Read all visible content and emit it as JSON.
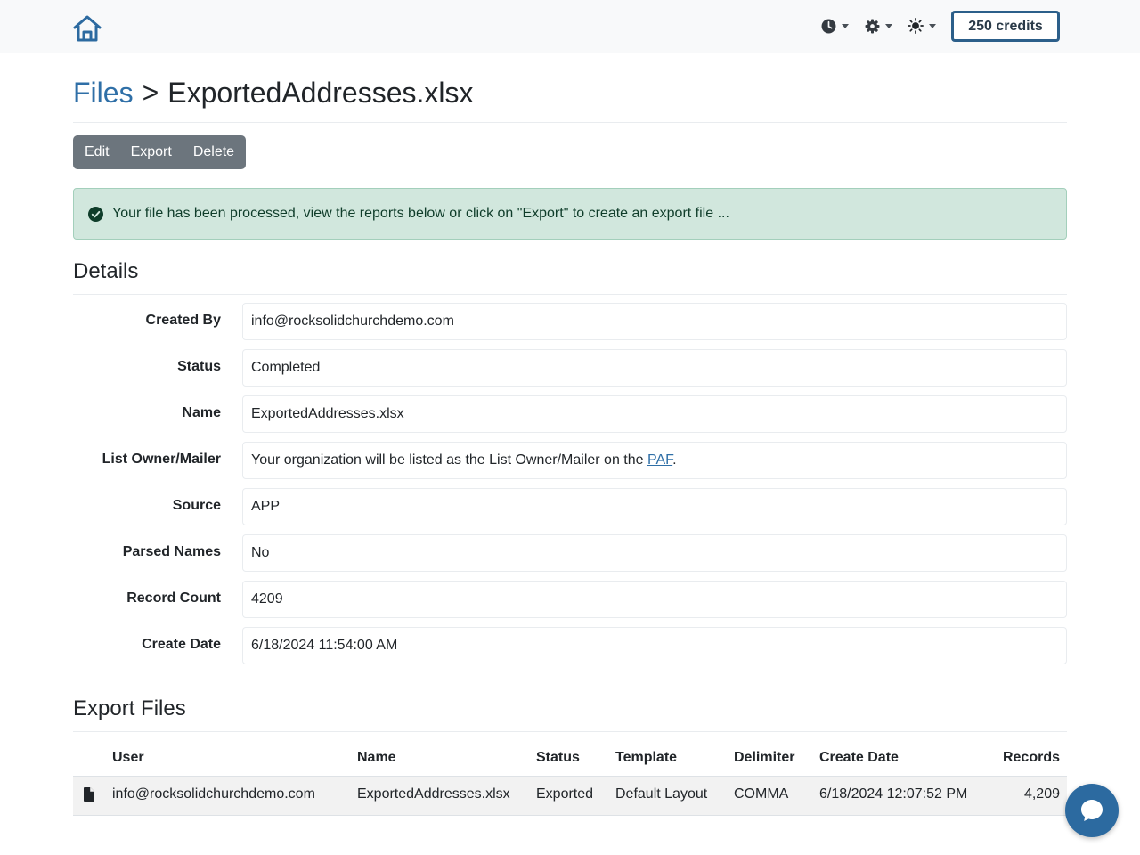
{
  "header": {
    "credits_label": "250 credits",
    "tools": [
      "clock-icon",
      "gear-icon",
      "sun-icon"
    ]
  },
  "breadcrumb": {
    "parent": "Files",
    "separator": ">",
    "current": "ExportedAddresses.xlsx"
  },
  "actions": {
    "edit": "Edit",
    "export": "Export",
    "delete": "Delete"
  },
  "alert": {
    "message": "Your file has been processed, view the reports below or click on \"Export\" to create an export file ..."
  },
  "details": {
    "title": "Details",
    "rows": [
      {
        "label": "Created By",
        "value": "info@rocksolidchurchdemo.com"
      },
      {
        "label": "Status",
        "value": "Completed"
      },
      {
        "label": "Name",
        "value": "ExportedAddresses.xlsx"
      },
      {
        "label": "List Owner/Mailer",
        "value": "Your organization will be listed as the List Owner/Mailer on the ",
        "link": "PAF",
        "suffix": "."
      },
      {
        "label": "Source",
        "value": "APP"
      },
      {
        "label": "Parsed Names",
        "value": "No"
      },
      {
        "label": "Record Count",
        "value": "4209"
      },
      {
        "label": "Create Date",
        "value": "6/18/2024 11:54:00 AM"
      }
    ]
  },
  "exports": {
    "title": "Export Files",
    "columns": {
      "user": "User",
      "name": "Name",
      "status": "Status",
      "template": "Template",
      "delimiter": "Delimiter",
      "create_date": "Create Date",
      "records": "Records"
    },
    "rows": [
      {
        "user": "info@rocksolidchurchdemo.com",
        "name": "ExportedAddresses.xlsx",
        "status": "Exported",
        "template": "Default Layout",
        "delimiter": "COMMA",
        "create_date": "6/18/2024 12:07:52 PM",
        "records": "4,209"
      }
    ]
  },
  "colors": {
    "accent": "#2f6fa7",
    "success_bg": "#d1e7dd",
    "button_gray": "#6c757d"
  }
}
